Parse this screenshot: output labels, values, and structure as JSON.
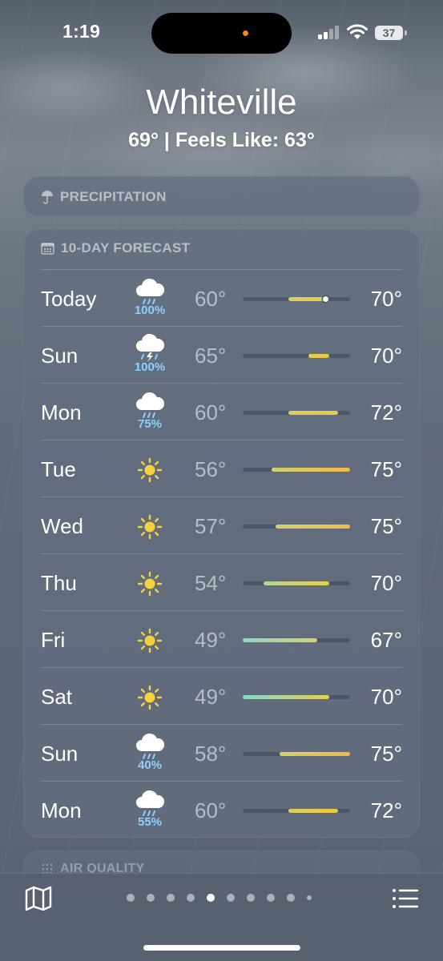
{
  "status_bar": {
    "time": "1:19",
    "battery": "37"
  },
  "header": {
    "location": "Whiteville",
    "temps_line": "69°  |  Feels Like: 63°"
  },
  "precip_card": {
    "title": "PRECIPITATION",
    "icon": "umbrella-icon"
  },
  "forecast": {
    "title": "10-DAY FORECAST",
    "icon": "calendar-icon",
    "range_min": 49,
    "range_max": 75,
    "current_temp": 69,
    "days": [
      {
        "day": "Today",
        "icon": "cloud-rain-icon",
        "precip": "100%",
        "low": "60°",
        "high": "70°",
        "low_val": 60,
        "high_val": 70,
        "grad": [
          "#d8d160",
          "#e7c94a"
        ]
      },
      {
        "day": "Sun",
        "icon": "cloud-thunder-icon",
        "precip": "100%",
        "low": "65°",
        "high": "70°",
        "low_val": 65,
        "high_val": 70,
        "grad": [
          "#e4cf4a",
          "#e8c84a"
        ]
      },
      {
        "day": "Mon",
        "icon": "cloud-rain-icon",
        "precip": "75%",
        "low": "60°",
        "high": "72°",
        "low_val": 60,
        "high_val": 72,
        "grad": [
          "#dbd05a",
          "#eec744"
        ]
      },
      {
        "day": "Tue",
        "icon": "sun-icon",
        "precip": "",
        "low": "56°",
        "high": "75°",
        "low_val": 56,
        "high_val": 75,
        "grad": [
          "#cfd170",
          "#f2b949"
        ]
      },
      {
        "day": "Wed",
        "icon": "sun-icon",
        "precip": "",
        "low": "57°",
        "high": "75°",
        "low_val": 57,
        "high_val": 75,
        "grad": [
          "#d4d16a",
          "#f2bc47"
        ]
      },
      {
        "day": "Thu",
        "icon": "sun-icon",
        "precip": "",
        "low": "54°",
        "high": "70°",
        "low_val": 54,
        "high_val": 70,
        "grad": [
          "#b2d69a",
          "#e5cd4e"
        ]
      },
      {
        "day": "Fri",
        "icon": "sun-icon",
        "precip": "",
        "low": "49°",
        "high": "67°",
        "low_val": 49,
        "high_val": 67,
        "grad": [
          "#8edbc8",
          "#d9d066"
        ]
      },
      {
        "day": "Sat",
        "icon": "sun-icon",
        "precip": "",
        "low": "49°",
        "high": "70°",
        "low_val": 49,
        "high_val": 70,
        "grad": [
          "#85d9cf",
          "#e3cd55"
        ]
      },
      {
        "day": "Sun",
        "icon": "cloud-rain-icon",
        "precip": "40%",
        "low": "58°",
        "high": "75°",
        "low_val": 58,
        "high_val": 75,
        "grad": [
          "#d6d264",
          "#f1b949"
        ]
      },
      {
        "day": "Mon",
        "icon": "cloud-rain-icon",
        "precip": "55%",
        "low": "60°",
        "high": "72°",
        "low_val": 60,
        "high_val": 72,
        "grad": [
          "#dbd05a",
          "#eec744"
        ]
      }
    ]
  },
  "air_quality": {
    "title": "AIR QUALITY"
  },
  "bottom_bar": {
    "pages": 10,
    "active_page": 5
  }
}
